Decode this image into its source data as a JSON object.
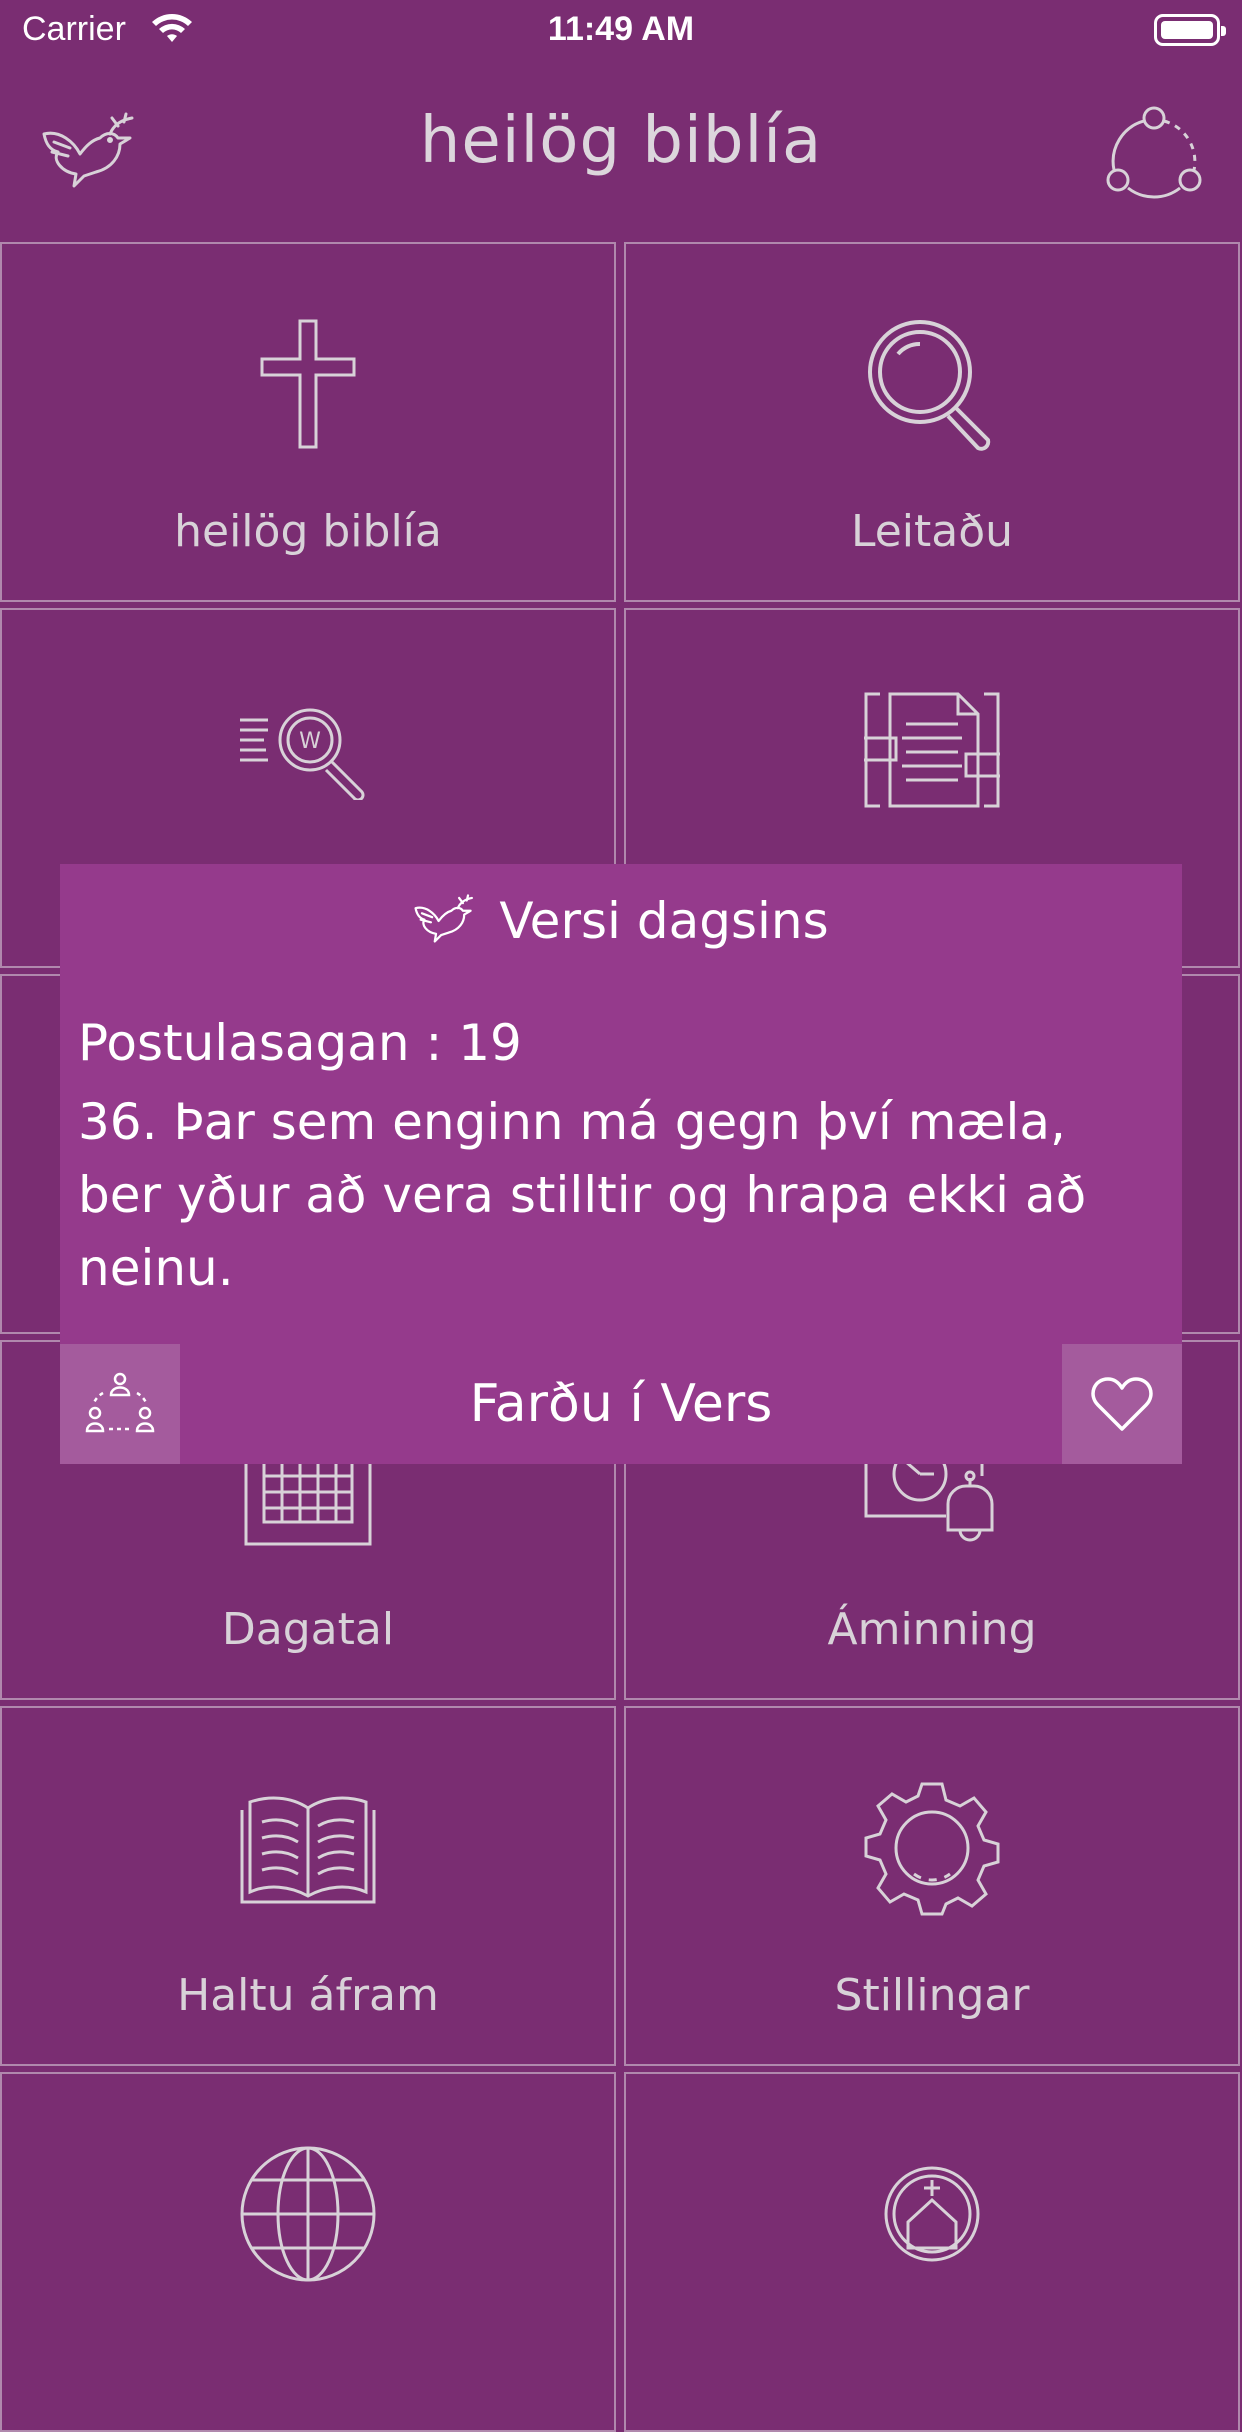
{
  "status_bar": {
    "carrier": "Carrier",
    "time": "11:49 AM"
  },
  "header": {
    "title": "heilög biblía",
    "left_icon": "dove-icon",
    "right_icon": "share-icon"
  },
  "tiles": [
    {
      "label": "heilög biblía",
      "icon": "cross-icon"
    },
    {
      "label": "Leitaðu",
      "icon": "search-icon"
    },
    {
      "label": "",
      "icon": "word-search-icon"
    },
    {
      "label": "",
      "icon": "document-icon"
    },
    {
      "label": "",
      "icon": ""
    },
    {
      "label": "",
      "icon": ""
    },
    {
      "label": "Dagatal",
      "icon": "calendar-icon"
    },
    {
      "label": "Áminning",
      "icon": "reminder-icon"
    },
    {
      "label": "Haltu áfram",
      "icon": "open-book-icon"
    },
    {
      "label": "Stillingar",
      "icon": "gear-icon"
    },
    {
      "label": "",
      "icon": "globe-icon"
    },
    {
      "label": "",
      "icon": "church-icon"
    }
  ],
  "verse_popup": {
    "title": "Versi dagsins",
    "reference": "Postulasagan : 19",
    "text": "36. Þar sem enginn má gegn því mæla, ber yður að vera stilltir og hrapa ekki að neinu.",
    "go_label": "Farðu í Vers",
    "share_icon": "people-share-icon",
    "favorite_icon": "heart-icon"
  },
  "colors": {
    "background": "#7a2d72",
    "popup": "#953a8c",
    "popup_button": "#a45b9d",
    "tile_border": "#b088ad",
    "text": "#d8d2d8"
  }
}
